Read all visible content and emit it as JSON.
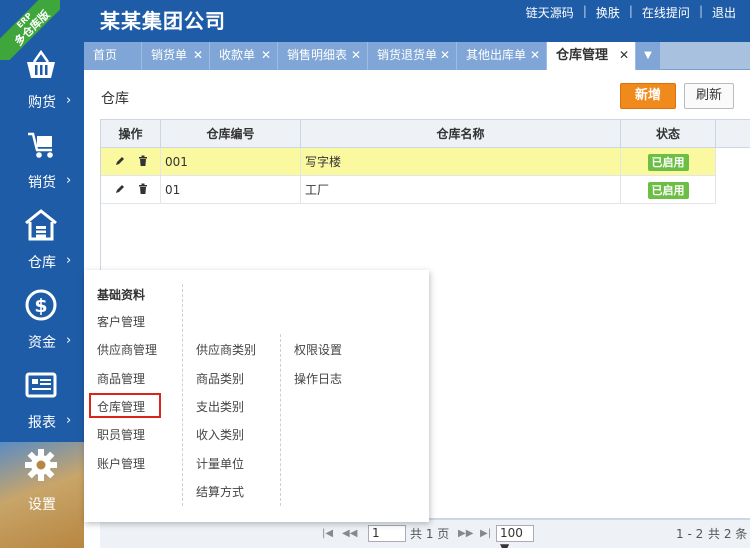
{
  "ribbon": {
    "line1": "ERP",
    "line2": "多仓库版"
  },
  "header": {
    "company": "某某集团公司",
    "links": [
      "链天源码",
      "换肤",
      "在线提问",
      "退出"
    ]
  },
  "sidebar": {
    "items": [
      {
        "label": "购货",
        "icon": "basket-icon"
      },
      {
        "label": "销货",
        "icon": "cart-icon"
      },
      {
        "label": "仓库",
        "icon": "warehouse-icon"
      },
      {
        "label": "资金",
        "icon": "dollar-icon"
      },
      {
        "label": "报表",
        "icon": "report-icon"
      },
      {
        "label": "设置",
        "icon": "gear-icon"
      }
    ],
    "arrow": "›"
  },
  "tabs": {
    "items": [
      "首页",
      "销货单",
      "收款单",
      "销售明细表",
      "销货退货单",
      "其他出库单",
      "仓库管理"
    ],
    "close": "✕",
    "more": "▼"
  },
  "page": {
    "title": "仓库",
    "new_label": "新增",
    "refresh_label": "刷新"
  },
  "grid": {
    "headers": [
      "操作",
      "仓库编号",
      "仓库名称",
      "状态"
    ],
    "rows": [
      {
        "code": "001",
        "name": "写字楼",
        "status": "已启用"
      },
      {
        "code": "01",
        "name": "工厂",
        "status": "已启用"
      }
    ]
  },
  "pager": {
    "page_value": "1",
    "total_pages": "共 1 页",
    "page_size": "100 ▼",
    "range": "1 - 2",
    "total": "共 2 条",
    "first": "|◀",
    "prev": "◀◀",
    "next": "▶▶",
    "last": "▶|"
  },
  "popup": {
    "section_title": "基础资料",
    "col1": [
      "客户管理",
      "供应商管理",
      "商品管理",
      "仓库管理",
      "职员管理",
      "账户管理"
    ],
    "col2": [
      "供应商类别",
      "商品类别",
      "支出类别",
      "收入类别",
      "计量单位",
      "结算方式"
    ],
    "col3": [
      "权限设置",
      "操作日志"
    ]
  },
  "colors": {
    "header_blue": "#1f5ca8",
    "tab_blue": "#7fa6d6",
    "accent_orange": "#f08a1c",
    "selected_row": "#fbf9a0",
    "status_green": "#6cbe45",
    "highlight_red": "#d9261c"
  }
}
